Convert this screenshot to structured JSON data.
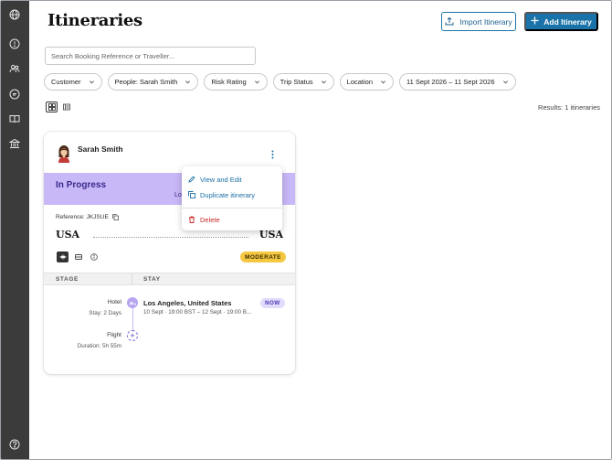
{
  "page": {
    "title": "Itineraries"
  },
  "actions": {
    "import_label": "Import Itinerary",
    "add_label": "Add Itinerary"
  },
  "search": {
    "placeholder": "Search Booking Reference or Traveller..."
  },
  "filters": [
    {
      "label": "Customer"
    },
    {
      "label": "People: Sarah Smith"
    },
    {
      "label": "Risk Rating"
    },
    {
      "label": "Trip Status"
    },
    {
      "label": "Location"
    },
    {
      "label": "11 Sept 2026 – 11 Sept 2026"
    }
  ],
  "results": {
    "text": "Results: 1 itineraries"
  },
  "card": {
    "traveller": "Sarah Smith",
    "status": "In Progress",
    "status_sub": "Lo",
    "reference": "Reference: JKJSUE",
    "origin": "USA",
    "destination": "USA",
    "risk": "MODERATE",
    "table": {
      "stage_header": "STAGE",
      "stay_header": "STAY"
    },
    "segments": {
      "hotel": {
        "label": "Hotel",
        "sub": "Stay: 2 Days",
        "name": "Los Angeles, United States",
        "dates": "10 Sept · 19:00 BST – 12 Sept · 19:00 B...",
        "badge": "NOW"
      },
      "flight": {
        "label": "Flight",
        "sub": "Duration: 5h 55m"
      }
    },
    "menu": {
      "view": "View and Edit",
      "duplicate": "Duplicate itinerary",
      "delete": "Delete"
    }
  },
  "colors": {
    "accent": "#1a73a8",
    "status_band": "#c8b8f7",
    "moderate": "#f5c842",
    "danger": "#c62828",
    "rail": "#3b3b3b"
  }
}
